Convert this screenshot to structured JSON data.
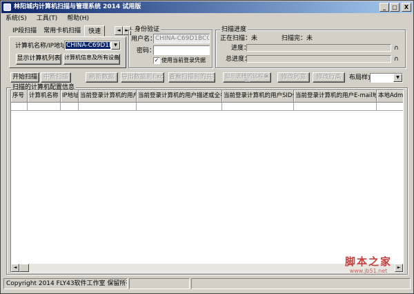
{
  "window": {
    "title": "林阳城内计算机扫描与管理系统 2014 试用版",
    "buttons": [
      "_",
      "□",
      "X"
    ]
  },
  "menu": [
    "系统(S)",
    "工具(T)",
    "帮助(H)"
  ],
  "scan_tabs": {
    "tabs": [
      "IP段扫描",
      "常用卡机扫描",
      "快速"
    ],
    "arrows": [
      "◄",
      "►"
    ],
    "computer_label": "计算机名称/IP地址",
    "computer_value": "CHINA-C69D1BCC8",
    "show_list_button": "显示计算机列表",
    "detail_button": "计算机信息及所有设备"
  },
  "auth": {
    "group_label": "身份验证",
    "username_label": "用户名：",
    "username_value": "CHINA-C69D1BCC8\\",
    "password_label": "密码：",
    "password_value": "",
    "checkbox_label": "使用当前登录凭据",
    "checkbox_checked": true
  },
  "progress": {
    "group_label": "扫描进度",
    "scanning_label": "正在扫描：未",
    "scanned_label": "扫描完：未",
    "progress_label": "进度：",
    "total_label": "总进度：",
    "progress_unit": "∩",
    "total_unit": "∩"
  },
  "toolbar": {
    "buttons": [
      {
        "label": "开始扫描",
        "enabled": true
      },
      {
        "label": "中断扫描",
        "enabled": false
      },
      {
        "label": "刷新数据",
        "enabled": false
      },
      {
        "label": "导出数据到Excel",
        "enabled": false
      },
      {
        "label": "查看扫描到的共享",
        "enabled": false
      },
      {
        "label": "显示选择的远程桌面",
        "enabled": false
      },
      {
        "label": "修改列宽",
        "enabled": false
      },
      {
        "label": "修改行高",
        "enabled": false
      }
    ],
    "group_label": "布局样式：",
    "group_value": ""
  },
  "grid": {
    "group_label": "扫描的计算机配置信息",
    "columns": [
      "序号",
      "计算机名称",
      "IP地址",
      "当前登录计算机的用户",
      "当前登录计算机的用户描述或全名",
      "当前登录计算机的用户SID值",
      "当前登录计算机的用户E-mail地",
      "本地Admin"
    ]
  },
  "status": {
    "copyright": "Copyright 2014 FLY43软件工作室 保留所有权利"
  },
  "watermark": {
    "main": "脚本之家",
    "sub": "www.jb51.net"
  }
}
